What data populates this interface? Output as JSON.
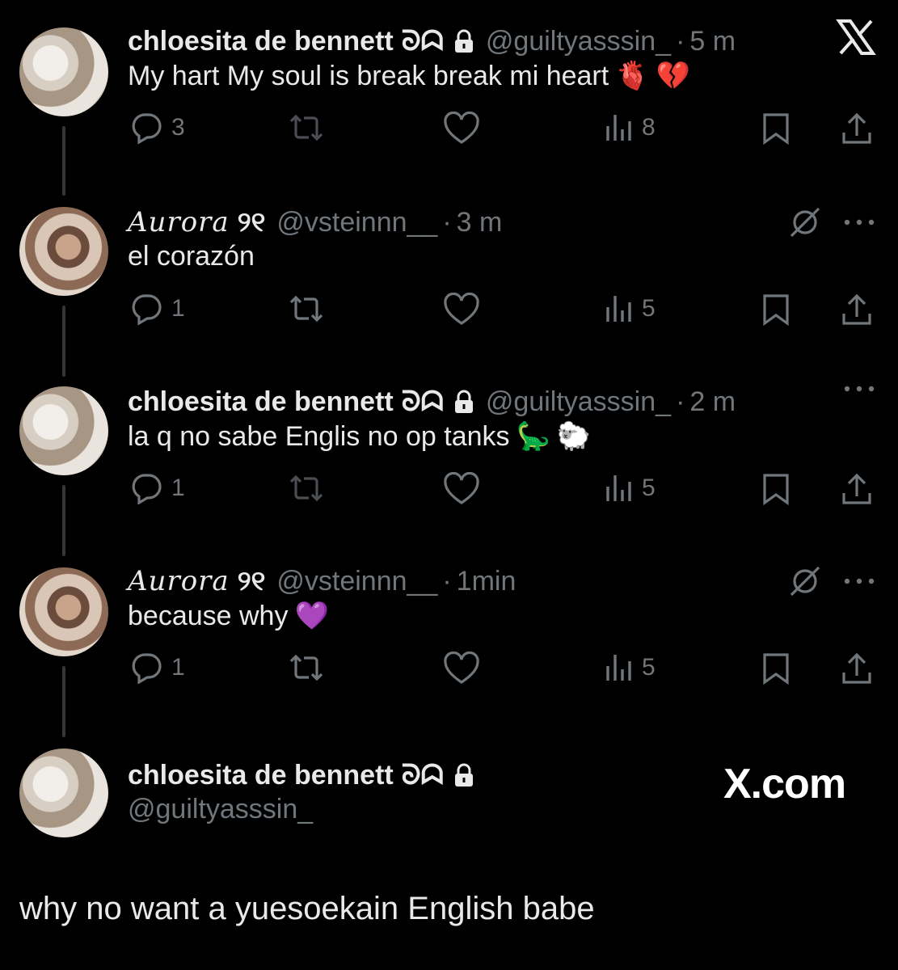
{
  "app": {
    "brand": "X.com"
  },
  "tweets": [
    {
      "author": "chloesita de bennett",
      "symbol": "ᘐᗣ",
      "handle": "@guiltyasssin_",
      "time": "5 m",
      "text": "My hart My soul is break break mi heart",
      "emojis": [
        "🫀",
        "💔"
      ],
      "replies": "3",
      "views": "8"
    },
    {
      "author": "Aurora",
      "symbol": "୨୧",
      "handle": "@vsteinnn__",
      "time": "3 m",
      "text": "el corazón",
      "emojis": [],
      "replies": "1",
      "views": "5"
    },
    {
      "author": "chloesita de bennett",
      "symbol": "ᘐᗣ",
      "handle": "@guiltyasssin_",
      "time": "2 m",
      "text": "la q no sabe Englis no op tanks",
      "emojis": [
        "🦕",
        "🐑"
      ],
      "replies": "1",
      "views": "5"
    },
    {
      "author": "Aurora",
      "symbol": "୨୧",
      "handle": "@vsteinnn__",
      "time": "1min",
      "text": "because why",
      "emojis": [
        "💜"
      ],
      "replies": "1",
      "views": "5"
    }
  ],
  "composer": {
    "author": "chloesita de bennett",
    "symbol": "ᘐᗣ",
    "handle": "@guiltyasssin_",
    "text": "why no want a yuesoekain English babe"
  },
  "colors": {
    "background": "#000000",
    "text": "#e7e9ea",
    "muted": "#71767b",
    "thread_line": "#333639"
  }
}
